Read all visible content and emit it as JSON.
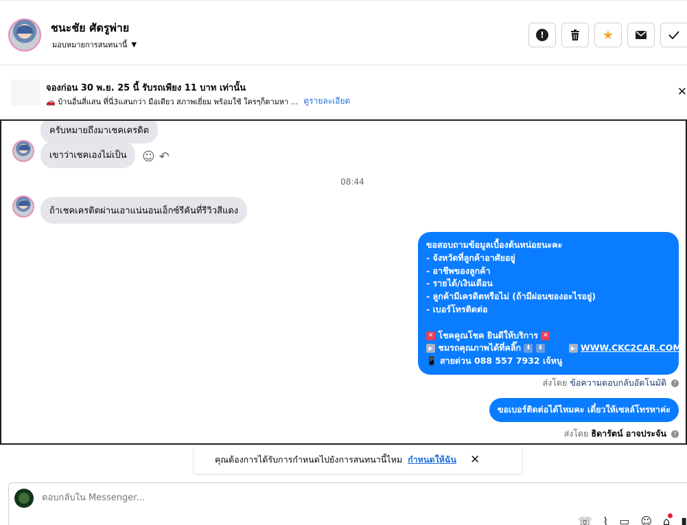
{
  "header": {
    "contact_name": "ชนะชัย ศัตรูพ่าย",
    "assign_label": "มอบหมายการสนทนานี้",
    "actions": [
      {
        "name": "mark-spam",
        "icon": "exclamation-circle-icon"
      },
      {
        "name": "delete",
        "icon": "trash-icon"
      },
      {
        "name": "follow-up",
        "icon": "star-icon"
      },
      {
        "name": "mark-unread",
        "icon": "envelope-icon"
      },
      {
        "name": "mark-done",
        "icon": "check-icon"
      }
    ]
  },
  "ad_banner": {
    "title": "จองก่อน 30 พ.ย. 25 นี้ รับรถเพียง 11 บาท เท่านั้น",
    "subtitle": "🚗 บ้านอื่นสี่แสน ที่นี่3แสนกว่า มือเดียว สภาพเยี่ยม พร้อมใช้ ใครๆก็ตามหา ...",
    "link": "ดูรายละเอียด"
  },
  "messages": {
    "incoming_1": "ครับหมายถึงมาเชคเครดิต",
    "incoming_2": "เขาว่าเชคเองไม่เป็น",
    "time_separator": "08:44",
    "incoming_3": "ถ้าเชคเครดิตผ่านเอาแน่นอนเอ็กซ์รีคันที่รีวิวสีแดง",
    "outgoing_auto": {
      "lines": [
        "ขอสอบถามข้อมูลเบื้องต้นหน่อยนะคะ",
        "- จังหวัดที่ลูกค้าอาศัยอยู่",
        "- อาชีพของลูกค้า",
        "- รายได้/เงินเดือน",
        "- ลูกค้ามีเครดิตหรือไม่ (ถ้ามีผ่อนของอะไรอยู่)",
        "- เบอร์โทรติดต่อ"
      ],
      "promo_line": "โชคคูณโชค ยินดีให้บริการ",
      "gallery_line": "ชมรถคุณภาพได้ที่คลิ๊ก",
      "website": "WWW.CKC2CAR.COM",
      "hotline_line": "สายด่วน 088 557 7932 เจ้หนู"
    },
    "sent_by_auto_prefix": "ส่งโดย",
    "sent_by_auto": "ข้อความตอบกลับอัตโนมัติ",
    "outgoing_2": "ขอเบอร์ติดต่อได้ไหมคะ เดี๋ยวให้เซลล์โทรหาค่ะ",
    "sent_by_agent_prefix": "ส่งโดย",
    "sent_by_agent": "ธิดารัตน์ อาจประจัน"
  },
  "reminder": {
    "text": "คุณต้องการได้รับการกำหนดไปยังการสนทนานี้ไหม",
    "link": "กำหนดให้ฉัน"
  },
  "composer": {
    "placeholder": "ตอบกลับใน Messenger...",
    "tools": [
      "add-contact-icon",
      "attachment-icon",
      "saved-replies-icon",
      "emoji-icon",
      "tag-icon",
      "signal-icon"
    ]
  },
  "colors": {
    "accent_blue": "#0a7cff",
    "incoming_bubble": "#e4e6eb",
    "link_blue": "#216fdb",
    "star": "#f5a623"
  }
}
